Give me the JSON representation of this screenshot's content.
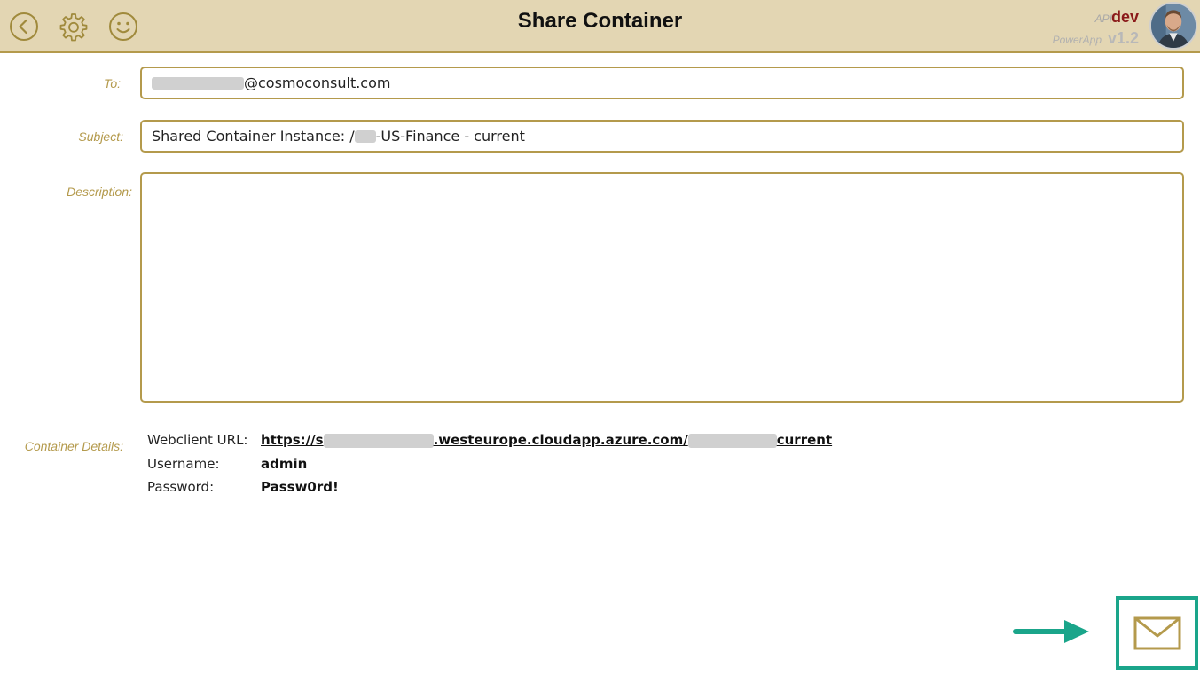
{
  "header": {
    "title": "Share Container",
    "api_label": "API",
    "api_value": "dev",
    "powerapp_label": "PowerApp",
    "powerapp_version": "v1.2",
    "icons": [
      "back-icon",
      "gear-icon",
      "smiley-icon"
    ]
  },
  "form": {
    "to": {
      "label": "To:",
      "value_suffix": "@cosmoconsult.com"
    },
    "subject": {
      "label": "Subject:",
      "value_prefix": "Shared Container Instance: /",
      "value_suffix": "-US-Finance - current"
    },
    "description": {
      "label": "Description:",
      "value": ""
    }
  },
  "details": {
    "label": "Container Details:",
    "webclient_key": "Webclient URL:",
    "webclient_prefix": "https://s",
    "webclient_middle": ".westeurope.cloudapp.azure.com/",
    "webclient_suffix": "current",
    "username_key": "Username:",
    "username_value": "admin",
    "password_key": "Password:",
    "password_value": "Passw0rd!"
  },
  "colors": {
    "accent": "#b49a4c",
    "header_bg": "#e3d6b3",
    "highlight": "#1aa58a",
    "api_value": "#8b1a1a"
  },
  "send": {
    "icon": "envelope-icon"
  }
}
